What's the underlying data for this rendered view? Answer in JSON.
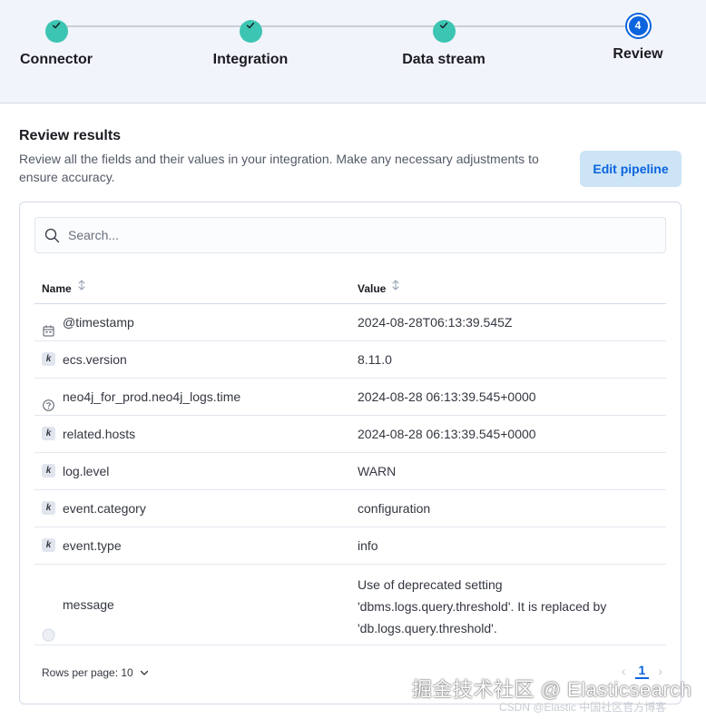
{
  "stepper": {
    "steps": [
      {
        "label": "Connector",
        "state": "complete",
        "icon": "check-icon"
      },
      {
        "label": "Integration",
        "state": "complete",
        "icon": "check-icon"
      },
      {
        "label": "Data stream",
        "state": "complete",
        "icon": "check-icon"
      },
      {
        "label": "Review",
        "state": "current",
        "number": "4"
      }
    ]
  },
  "review": {
    "title": "Review results",
    "description": "Review all the fields and their values in your integration. Make any necessary adjustments to ensure accuracy.",
    "edit_pipeline_label": "Edit pipeline"
  },
  "search": {
    "placeholder": "Search...",
    "value": ""
  },
  "table": {
    "columns": [
      "Name",
      "Value"
    ],
    "rows": [
      {
        "type_icon": "calendar-icon",
        "name": "@timestamp",
        "value": "2024-08-28T06:13:39.545Z"
      },
      {
        "type_icon": "keyword-icon",
        "name": "ecs.version",
        "value": "8.11.0"
      },
      {
        "type_icon": "question-icon",
        "name": "neo4j_for_prod.neo4j_logs.time",
        "value": "2024-08-28 06:13:39.545+0000"
      },
      {
        "type_icon": "keyword-icon",
        "name": "related.hosts",
        "value": "2024-08-28 06:13:39.545+0000"
      },
      {
        "type_icon": "keyword-icon",
        "name": "log.level",
        "value": "WARN"
      },
      {
        "type_icon": "keyword-icon",
        "name": "event.category",
        "value": "configuration"
      },
      {
        "type_icon": "keyword-icon",
        "name": "event.type",
        "value": "info"
      },
      {
        "type_icon": "text-icon",
        "name": "message",
        "value": "Use of deprecated setting 'dbms.logs.query.threshold'. It is replaced by 'db.logs.query.threshold'."
      }
    ]
  },
  "pagination": {
    "rows_per_page_label": "Rows per page: 10",
    "current_page": "1",
    "prev": "‹",
    "next": "›"
  },
  "watermark": {
    "main": "掘金技术社区 @ Elasticsearch",
    "small": "CSDN @Elastic 中国社区官方博客"
  },
  "colors": {
    "step_complete": "#3cc5b2",
    "step_current": "#0b64dd",
    "primary": "#0b64dd",
    "button_bg": "#cce4f5"
  }
}
